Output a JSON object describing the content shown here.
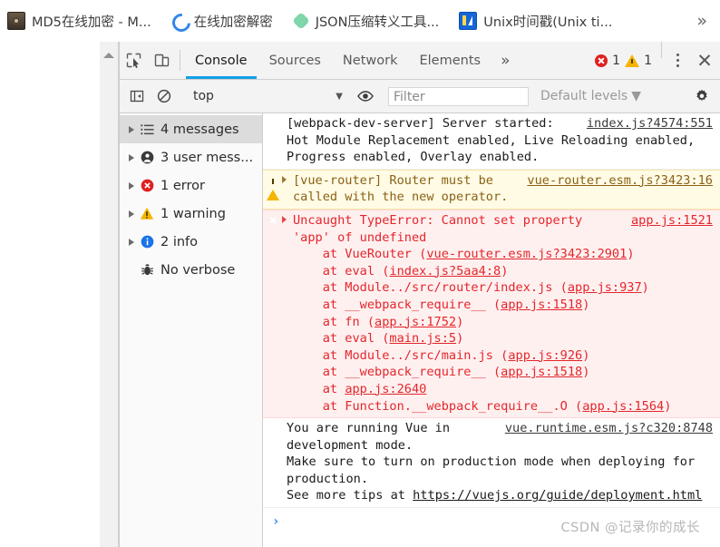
{
  "bookmarks_bar": {
    "items": [
      {
        "label": "MD5在线加密 - M...",
        "icon": "md5-camera-icon"
      },
      {
        "label": "在线加密解密",
        "icon": "blue-c-icon"
      },
      {
        "label": "JSON压缩转义工具...",
        "icon": "green-flower-icon"
      },
      {
        "label": "Unix时间戳(Unix ti...",
        "icon": "unix-chart-icon"
      }
    ],
    "overflow_label": "»"
  },
  "devtools": {
    "tabs": [
      {
        "label": "Console",
        "active": true
      },
      {
        "label": "Sources",
        "active": false
      },
      {
        "label": "Network",
        "active": false
      },
      {
        "label": "Elements",
        "active": false
      }
    ],
    "more_tabs_label": "»",
    "counts": {
      "errors": "1",
      "warnings": "1"
    },
    "close_label": "✕",
    "icons": {
      "inspect": "inspect-element-icon",
      "device": "device-toolbar-icon",
      "kebab": "more-options-icon"
    },
    "toolbar": {
      "context_value": "top",
      "context_arrow": "▼",
      "filter_placeholder": "Filter",
      "filter_value": "",
      "levels_label": "Default levels",
      "levels_arrow": "▼",
      "icons": {
        "sidebar": "show-console-sidebar-icon",
        "clear": "clear-console-icon",
        "eye": "live-expression-icon",
        "settings": "settings-gear-icon"
      }
    },
    "sidebar": [
      {
        "label": "4 messages",
        "icon": "list-icon",
        "selected": true,
        "expandable": true
      },
      {
        "label": "3 user mess...",
        "icon": "person-icon",
        "selected": false,
        "expandable": true
      },
      {
        "label": "1 error",
        "icon": "error-icon",
        "selected": false,
        "expandable": true
      },
      {
        "label": "1 warning",
        "icon": "warning-icon",
        "selected": false,
        "expandable": true
      },
      {
        "label": "2 info",
        "icon": "info-icon",
        "selected": false,
        "expandable": true
      },
      {
        "label": "No verbose",
        "icon": "bug-icon",
        "selected": false,
        "expandable": false
      }
    ],
    "messages": [
      {
        "level": "plain",
        "source": "index.js?4574:551",
        "text": "[webpack-dev-server] Server started: Hot Module Replacement enabled, Live Reloading enabled, Progress enabled, Overlay enabled.",
        "expandable": false
      },
      {
        "level": "warn",
        "source": "vue-router.esm.js?3423:16",
        "text": "[vue-router] Router must be called with the new operator.",
        "expandable": true
      },
      {
        "level": "err",
        "source": "app.js:1521",
        "text": "Uncaught TypeError: Cannot set property 'app' of undefined",
        "expandable": true,
        "stack": [
          {
            "prefix": "    at VueRouter (",
            "link": "vue-router.esm.js?3423:2901",
            "suffix": ")"
          },
          {
            "prefix": "    at eval (",
            "link": "index.js?5aa4:8",
            "suffix": ")"
          },
          {
            "prefix": "    at Module../src/router/index.js (",
            "link": "app.js:937",
            "suffix": ")"
          },
          {
            "prefix": "    at __webpack_require__ (",
            "link": "app.js:1518",
            "suffix": ")"
          },
          {
            "prefix": "    at fn (",
            "link": "app.js:1752",
            "suffix": ")"
          },
          {
            "prefix": "    at eval (",
            "link": "main.js:5",
            "suffix": ")"
          },
          {
            "prefix": "    at Module../src/main.js (",
            "link": "app.js:926",
            "suffix": ")"
          },
          {
            "prefix": "    at __webpack_require__ (",
            "link": "app.js:1518",
            "suffix": ")"
          },
          {
            "prefix": "    at ",
            "link": "app.js:2640",
            "suffix": ""
          },
          {
            "prefix": "    at Function.__webpack_require__.O (",
            "link": "app.js:1564",
            "suffix": ")"
          }
        ]
      },
      {
        "level": "plain",
        "source": "vue.runtime.esm.js?c320:8748",
        "text": "You are running Vue in development mode.\nMake sure to turn on production mode when deploying for production.\nSee more tips at ",
        "trailing_link": "https://vuejs.org/guide/deployment.html",
        "expandable": false
      }
    ],
    "prompt_caret": "›"
  },
  "watermark": "CSDN @记录你的成长"
}
